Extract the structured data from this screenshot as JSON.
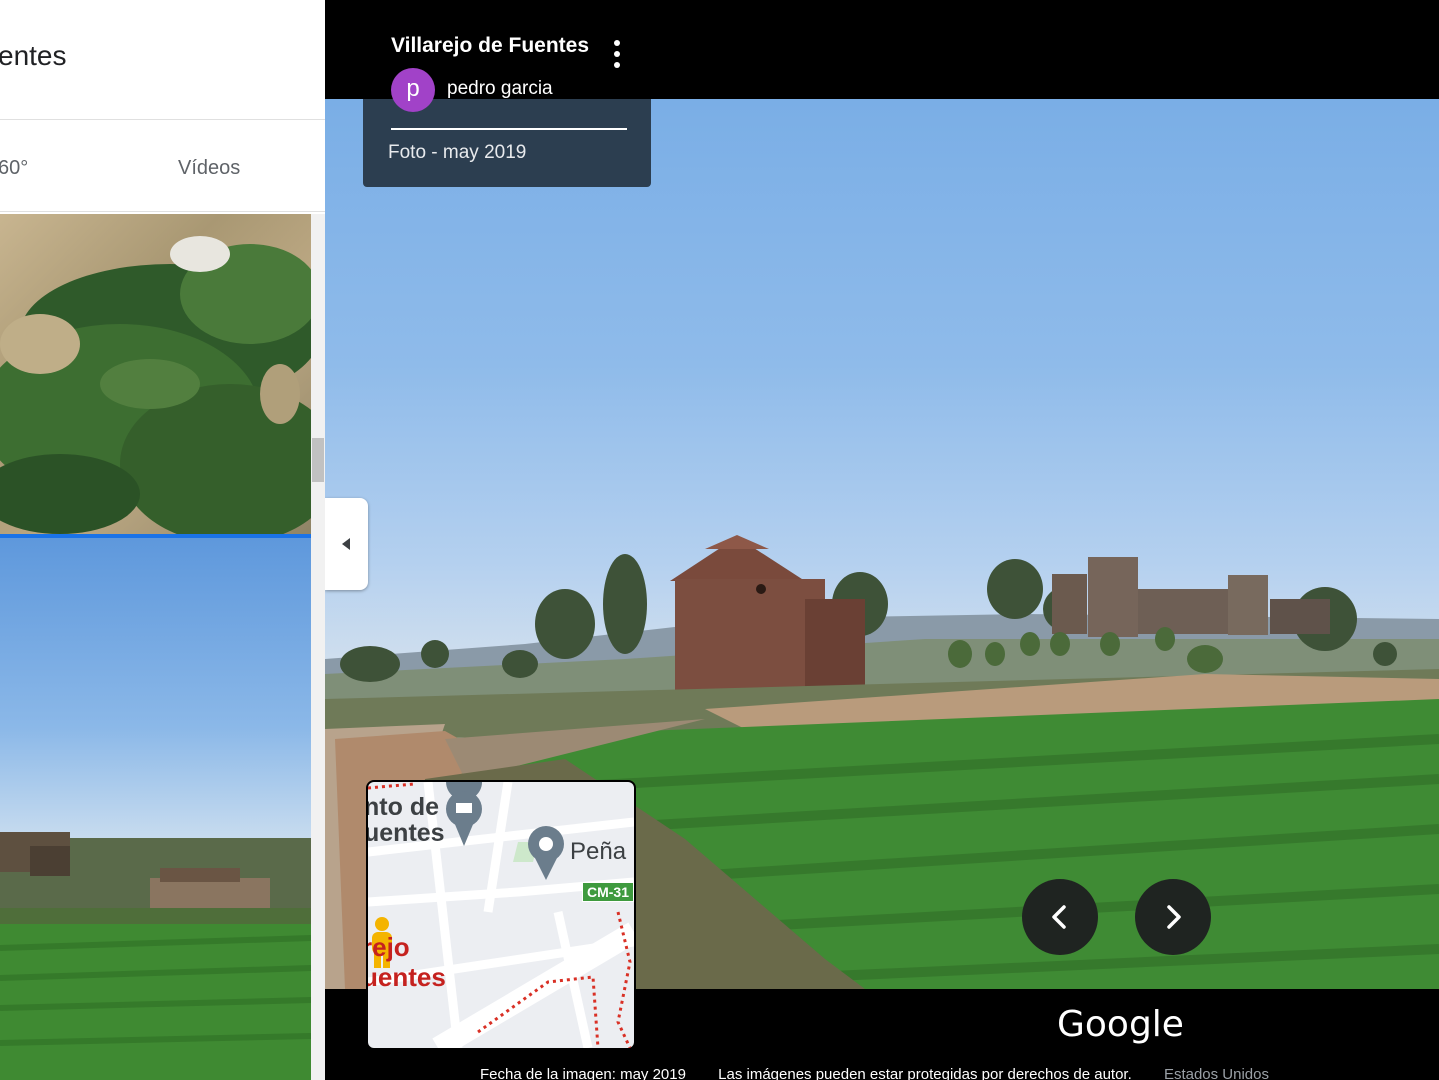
{
  "left_panel": {
    "title": "entes",
    "tabs": [
      {
        "label": "60°"
      },
      {
        "label": "Vídeos"
      }
    ]
  },
  "viewer": {
    "info_card": {
      "title": "Villarejo de Fuentes",
      "author_initial": "p",
      "author": "pedro garcia",
      "date": "Foto - may 2019"
    },
    "minimap": {
      "label_1": "nto de\nuentes",
      "label_2": "Peña",
      "road_badge": "CM-31",
      "label_3": "rejo\nuentes"
    },
    "brand": "Google",
    "footer": {
      "image_date": "Fecha de la imagen: may 2019",
      "copyright": "Las imágenes pueden estar protegidas por derechos de autor.",
      "country": "Estados Unidos"
    }
  },
  "colors": {
    "avatar": "#a142c8",
    "selected_thumb": "#1a73e8",
    "info_card": "#2c3e50"
  }
}
